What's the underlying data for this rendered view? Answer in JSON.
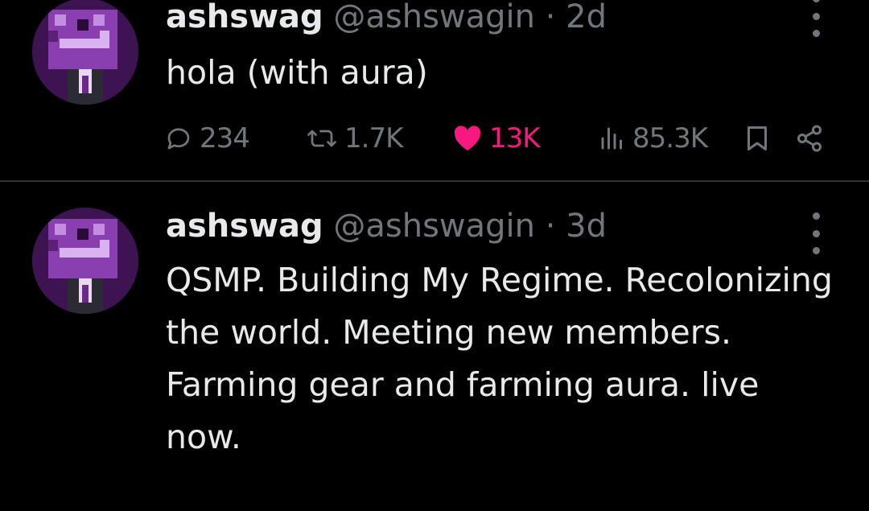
{
  "colors": {
    "background": "#000000",
    "text": "#e7e9ea",
    "muted": "#71767b",
    "like": "#f91880",
    "avatar": "#8a3fb0"
  },
  "tweets": [
    {
      "name": "ashswag",
      "handle": "@ashswagin",
      "separator": "·",
      "time": "2d",
      "text": "hola (with aura)",
      "actions": {
        "replies": "234",
        "reposts": "1.7K",
        "likes": "13K",
        "views": "85.3K"
      },
      "icons": [
        "reply-icon",
        "repost-icon",
        "heart-icon",
        "views-icon",
        "bookmark-icon",
        "share-icon",
        "more-icon"
      ]
    },
    {
      "name": "ashswag",
      "handle": "@ashswagin",
      "separator": "·",
      "time": "3d",
      "text": "QSMP. Building My Regime. Recolonizing the world. Meeting new members. Farming gear and farming aura. live now."
    }
  ]
}
